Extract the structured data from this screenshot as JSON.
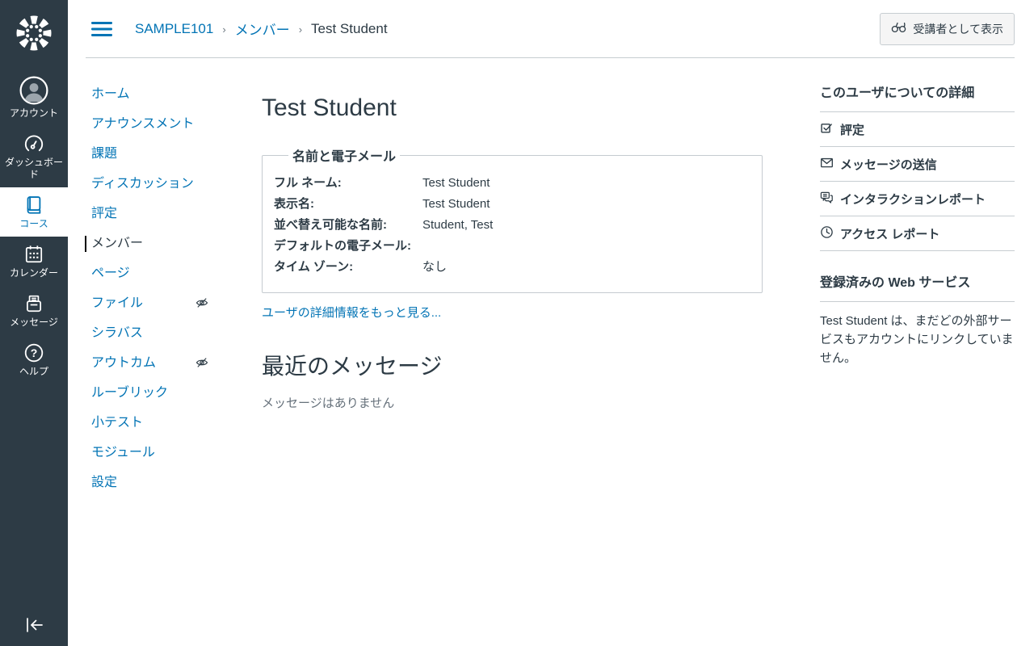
{
  "colors": {
    "nav_bg": "#2D3B45",
    "accent_blue": "#0374B5",
    "text_dark": "#2D3B45",
    "divider": "#C7CDD1",
    "button_bg": "#F5F5F5",
    "active_marker": "#000000"
  },
  "global_nav": {
    "logo_icon": "canvas-logo",
    "help_glyph": "?",
    "items": [
      {
        "label": "アカウント",
        "icon": "user-icon",
        "active": false
      },
      {
        "label": "ダッシュボード",
        "icon": "dashboard-gauge-icon",
        "active": false
      },
      {
        "label": "コース",
        "icon": "courses-book-icon",
        "active": true
      },
      {
        "label": "カレンダー",
        "icon": "calendar-icon",
        "active": false
      },
      {
        "label": "メッセージ",
        "icon": "inbox-icon",
        "active": false
      },
      {
        "label": "ヘルプ",
        "icon": "help-icon",
        "active": false
      }
    ],
    "collapse_icon": "collapse-left-arrow-icon"
  },
  "header": {
    "menu_icon": "hamburger-icon",
    "breadcrumb": {
      "items": [
        "SAMPLE101",
        "メンバー",
        "Test Student"
      ],
      "separator": "›"
    },
    "view_as_student_button": {
      "label": "受講者として表示",
      "icon": "glasses-icon"
    }
  },
  "course_nav": {
    "items": [
      {
        "label": "ホーム",
        "active": false,
        "hidden_indicator": false
      },
      {
        "label": "アナウンスメント",
        "active": false,
        "hidden_indicator": false
      },
      {
        "label": "課題",
        "active": false,
        "hidden_indicator": false
      },
      {
        "label": "ディスカッション",
        "active": false,
        "hidden_indicator": false
      },
      {
        "label": "評定",
        "active": false,
        "hidden_indicator": false
      },
      {
        "label": "メンバー",
        "active": true,
        "hidden_indicator": false
      },
      {
        "label": "ページ",
        "active": false,
        "hidden_indicator": false
      },
      {
        "label": "ファイル",
        "active": false,
        "hidden_indicator": true
      },
      {
        "label": "シラバス",
        "active": false,
        "hidden_indicator": false
      },
      {
        "label": "アウトカム",
        "active": false,
        "hidden_indicator": true
      },
      {
        "label": "ルーブリック",
        "active": false,
        "hidden_indicator": false
      },
      {
        "label": "小テスト",
        "active": false,
        "hidden_indicator": false
      },
      {
        "label": "モジュール",
        "active": false,
        "hidden_indicator": false
      },
      {
        "label": "設定",
        "active": false,
        "hidden_indicator": false
      }
    ],
    "hidden_icon": "eye-slash-icon"
  },
  "main": {
    "title": "Test Student",
    "name_email_fieldset": {
      "legend": "名前と電子メール",
      "fields": [
        {
          "label": "フル ネーム:",
          "value": "Test Student"
        },
        {
          "label": "表示名:",
          "value": "Test Student"
        },
        {
          "label": "並べ替え可能な名前:",
          "value": "Student, Test"
        },
        {
          "label": "デフォルトの電子メール:",
          "value": ""
        },
        {
          "label": "タイム ゾーン:",
          "value": "なし"
        }
      ]
    },
    "more_details_link": "ユーザの詳細情報をもっと見る...",
    "recent_messages_heading": "最近のメッセージ",
    "no_messages_text": "メッセージはありません"
  },
  "right_sidebar": {
    "details_heading": "このユーザについての詳細",
    "links": [
      {
        "label": "評定",
        "icon": "gradebook-check-icon"
      },
      {
        "label": "メッセージの送信",
        "icon": "envelope-icon"
      },
      {
        "label": "インタラクションレポート",
        "icon": "speech-bubbles-icon"
      },
      {
        "label": "アクセス レポート",
        "icon": "clock-icon"
      }
    ],
    "services_heading": "登録済みの Web サービス",
    "services_text": "Test Student は、まだどの外部サービスもアカウントにリンクしていません。"
  }
}
